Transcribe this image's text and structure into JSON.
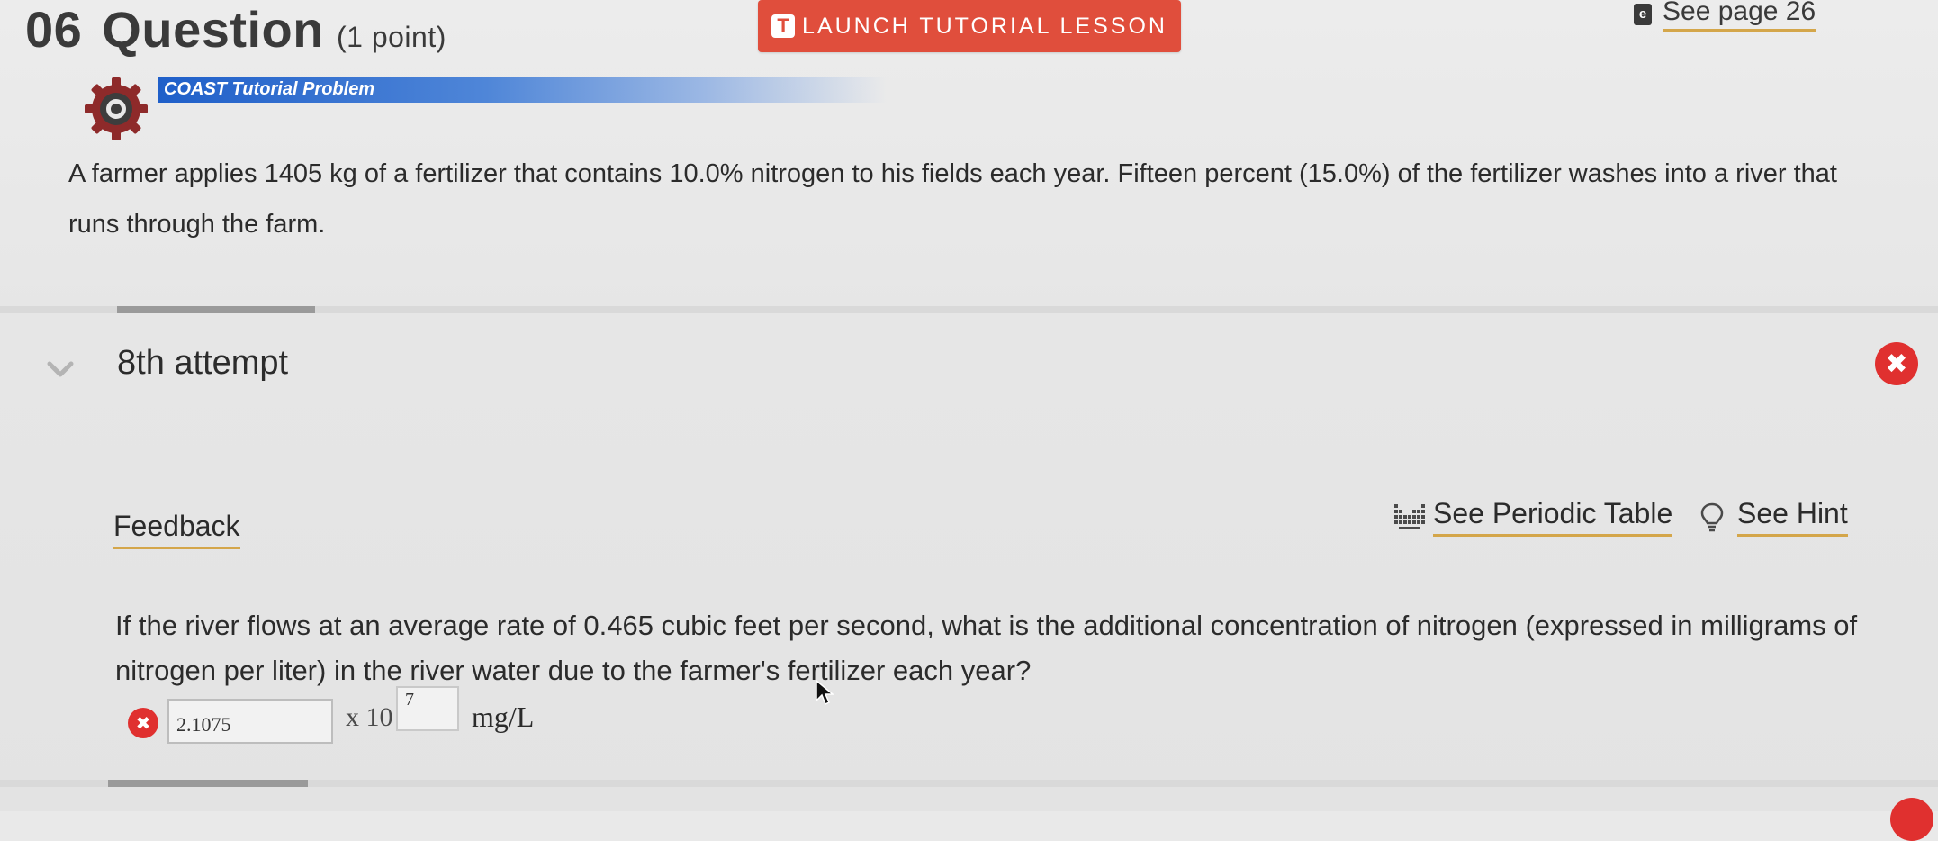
{
  "header": {
    "question_number": "06",
    "question_word": "Question",
    "points": "(1 point)",
    "launch_icon": "T",
    "launch_label": "LAUNCH TUTORIAL LESSON",
    "book_icon": "e",
    "see_page_label": "See page 26"
  },
  "coast": {
    "banner_label": "COAST Tutorial Problem",
    "icon": "gear-icon"
  },
  "problem": {
    "text": "A farmer applies 1405 kg of a fertilizer that contains 10.0% nitrogen to his fields each year. Fifteen percent (15.0%) of the fertilizer washes into a river that runs through the farm."
  },
  "attempt": {
    "title": "8th attempt",
    "expand_icon": "chevron-down-icon",
    "close_icon": "close-icon",
    "close_glyph": "✖"
  },
  "links": {
    "feedback": "Feedback",
    "periodic_table": "See Periodic Table",
    "hint": "See Hint"
  },
  "question": {
    "text": "If the river flows at an average rate of 0.465 cubic feet per second, what is the additional concentration of nitrogen (expressed in milligrams of nitrogen per liter) in the river water due to the farmer's fertilizer each year?"
  },
  "answer": {
    "status_glyph": "✖",
    "mantissa_value": "2.1075",
    "times_label": "x 10",
    "exponent_value": "7",
    "unit": "mg/L"
  },
  "colors": {
    "accent_red": "#e04e3c",
    "error_red": "#e0302f",
    "link_underline": "#d4a64a",
    "banner_blue": "#1f5fc9"
  }
}
